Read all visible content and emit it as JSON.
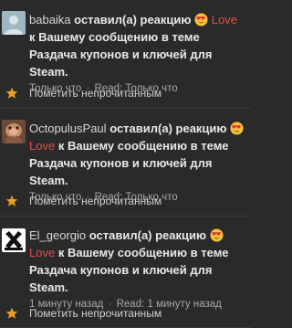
{
  "notifications": [
    {
      "user": "babaika",
      "action": "оставил(а) реакцию",
      "reaction": "Love",
      "preposition": "к",
      "message_text": "Вашему сообщению в теме Раздача купонов и ключей для Steam.",
      "time": "Только что",
      "read_label": "Read:",
      "read_time": "Только что",
      "mark_unread": "Пометить непрочитанным",
      "avatar_icon": "avatar-placeholder-icon"
    },
    {
      "user": "OctopulusPaul",
      "action": "оставил(а) реакцию",
      "reaction": "Love",
      "preposition": "к",
      "message_text": "Вашему сообщению в теме Раздача купонов и ключей для Steam.",
      "time": "Только что",
      "read_label": "Read:",
      "read_time": "Только что",
      "mark_unread": "Пометить непрочитанным",
      "avatar_icon": "avatar-photo-icon"
    },
    {
      "user": "El_georgio",
      "action": "оставил(а) реакцию",
      "reaction": "Love",
      "preposition": "к",
      "message_text": "Вашему сообщению в теме Раздача купонов и ключей для Steam.",
      "time": "1 минуту назад",
      "read_label": "Read:",
      "read_time": "1 минуту назад",
      "mark_unread": "Пометить непрочитанным",
      "avatar_icon": "avatar-logo-icon"
    }
  ],
  "colors": {
    "background": "#2a2a2a",
    "love": "#e0504a",
    "star": "#e8a020",
    "meta": "#a8a8a8"
  }
}
